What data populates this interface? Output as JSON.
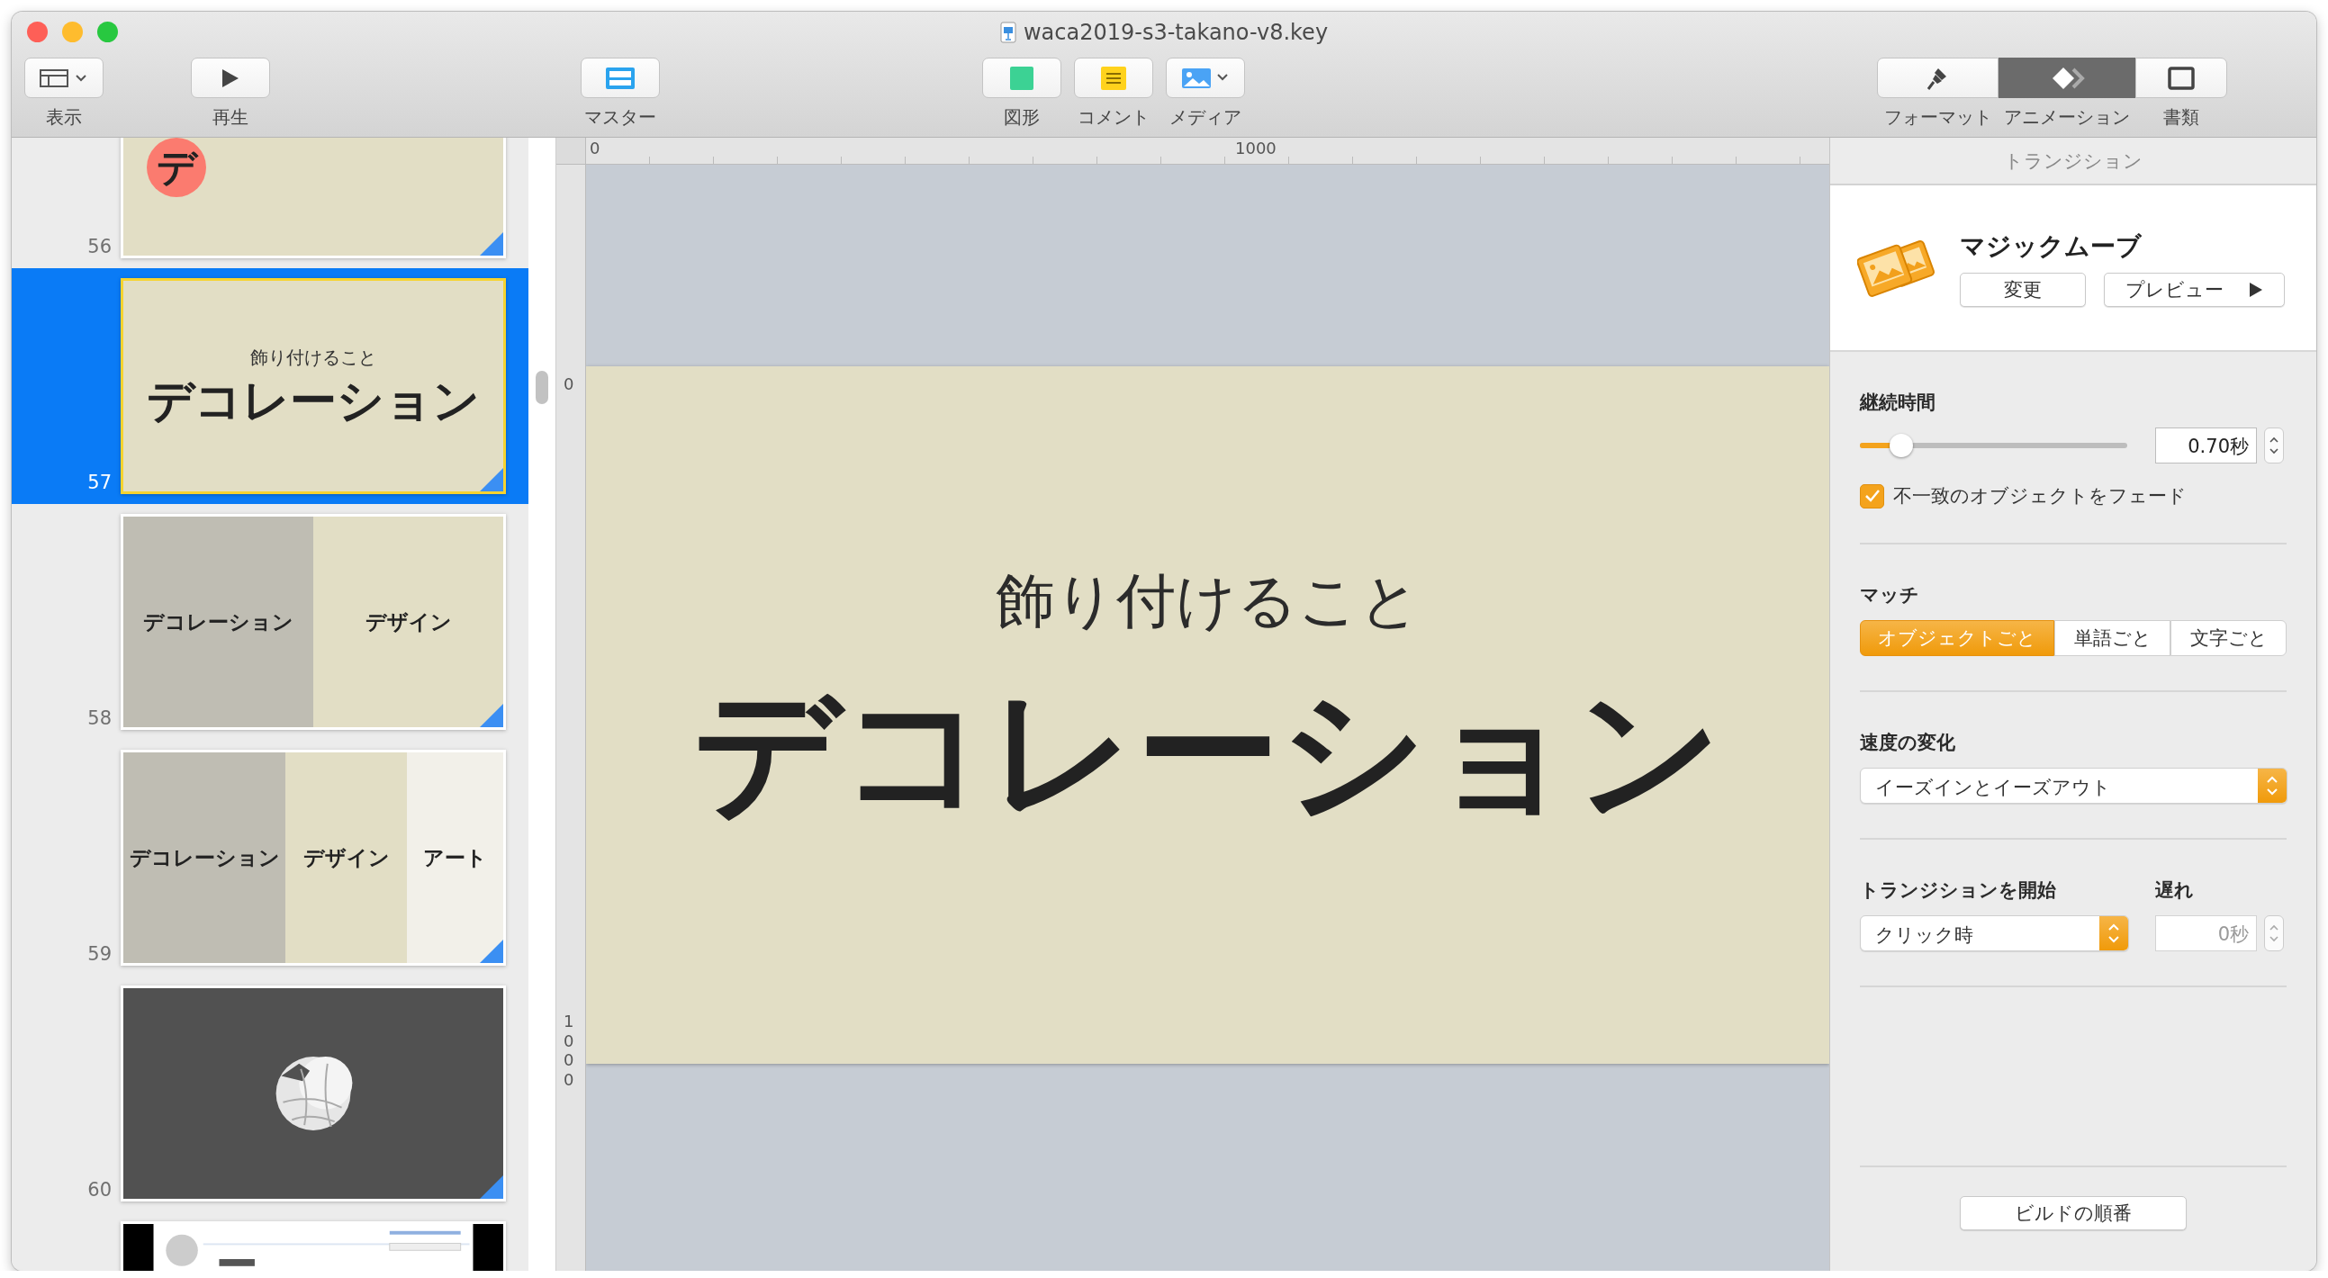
{
  "window": {
    "title": "waca2019-s3-takano-v8.key"
  },
  "toolbar": [
    {
      "items": [
        {
          "label": "表示",
          "kind": "view"
        },
        {
          "label": "再生",
          "kind": "play"
        }
      ]
    },
    {
      "items": [
        {
          "label": "マスター",
          "kind": "master"
        }
      ]
    },
    {
      "items": [
        {
          "label": "図形",
          "kind": "shape"
        },
        {
          "label": "コメント",
          "kind": "comment"
        },
        {
          "label": "メディア",
          "kind": "media"
        }
      ]
    }
  ],
  "inspector_tabs": [
    {
      "label": "フォーマット",
      "kind": "format",
      "selected": false
    },
    {
      "label": "アニメーション",
      "kind": "animate",
      "selected": true
    },
    {
      "label": "書類",
      "kind": "document",
      "selected": false
    }
  ],
  "slides": [
    {
      "number": "56",
      "kind": "badge",
      "selected": false,
      "transition": true,
      "texts": [
        "デ"
      ]
    },
    {
      "number": "57",
      "kind": "title",
      "selected": true,
      "transition": true,
      "texts": [
        "飾り付けること",
        "デコレーション"
      ]
    },
    {
      "number": "58",
      "kind": "columns",
      "selected": false,
      "transition": true,
      "texts": [
        "デコレーション",
        "デザイン"
      ]
    },
    {
      "number": "59",
      "kind": "columns",
      "selected": false,
      "transition": true,
      "texts": [
        "デコレーション",
        "デザイン",
        "アート"
      ]
    },
    {
      "number": "60",
      "kind": "picture",
      "selected": false,
      "transition": true
    },
    {
      "kind": "screenshot",
      "selected": false,
      "transition": false
    }
  ],
  "ruler": {
    "x_labels": [
      "0",
      "1000"
    ],
    "y_labels": [
      "0",
      "1000"
    ]
  },
  "slide": {
    "subtitle": "飾り付けること",
    "title": "デコレーション"
  },
  "inspector": {
    "header": "トランジション",
    "effect": {
      "name": "マジックムーブ",
      "change_button": "変更",
      "preview_button": "プレビュー"
    },
    "duration": {
      "label": "継続時間",
      "level": 0.155,
      "value": "0.70秒"
    },
    "fade": {
      "label": "不一致のオブジェクトをフェード",
      "checked": true
    },
    "match": {
      "label": "マッチ",
      "options": [
        {
          "label": "オブジェクトごと",
          "selected": true
        },
        {
          "label": "単語ごと",
          "selected": false
        },
        {
          "label": "文字ごと",
          "selected": false
        }
      ]
    },
    "acceleration": {
      "label": "速度の変化",
      "value": "イーズインとイーズアウト"
    },
    "start": {
      "label": "トランジションを開始",
      "value": "クリック時"
    },
    "delay": {
      "label": "遅れ",
      "value": "0秒",
      "disabled": true
    },
    "build_order_button": "ビルドの順番"
  }
}
